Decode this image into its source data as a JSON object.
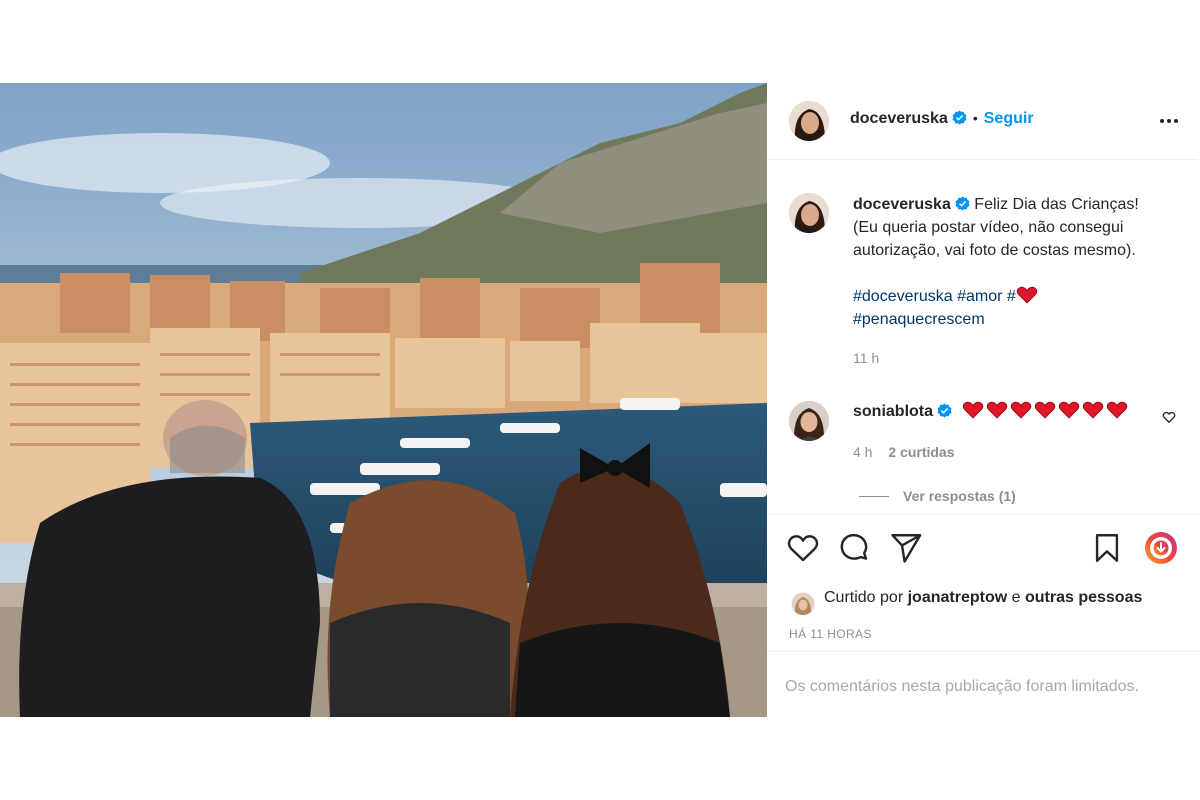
{
  "post": {
    "author": "doceveruska",
    "follow_label": "Seguir",
    "separator": "•",
    "caption": {
      "line1": "Feliz Dia das Crianças!",
      "line2": "(Eu queria postar vídeo, não consegui",
      "line3": "autorização, vai foto de costas mesmo).",
      "hashtags": [
        "#doceveruska",
        "#amor",
        "#",
        "#penaquecrescem"
      ],
      "timestamp": "11 h"
    },
    "comment": {
      "author": "soniablota",
      "hearts": 7,
      "timestamp": "4 h",
      "likes": "2 curtidas",
      "replies_label": "Ver respostas (1)"
    },
    "liked_by": {
      "prefix": "Curtido por",
      "user": "joanatreptow",
      "conjunction": "e",
      "others": "outras pessoas"
    },
    "time_ago": "HÁ 11 HORAS",
    "comments_limited": "Os comentários nesta publicação foram limitados."
  },
  "icons": {
    "verified": "verified-badge-icon",
    "more": "more-options-icon",
    "like": "heart-outline-icon",
    "comment": "comment-bubble-icon",
    "share": "paper-plane-icon",
    "save": "bookmark-icon",
    "comment_like": "small-heart-icon"
  },
  "colors": {
    "accent": "#0095f6",
    "hashtag": "#00376b",
    "heart": "#e0142b",
    "muted": "#8e8e8e"
  }
}
